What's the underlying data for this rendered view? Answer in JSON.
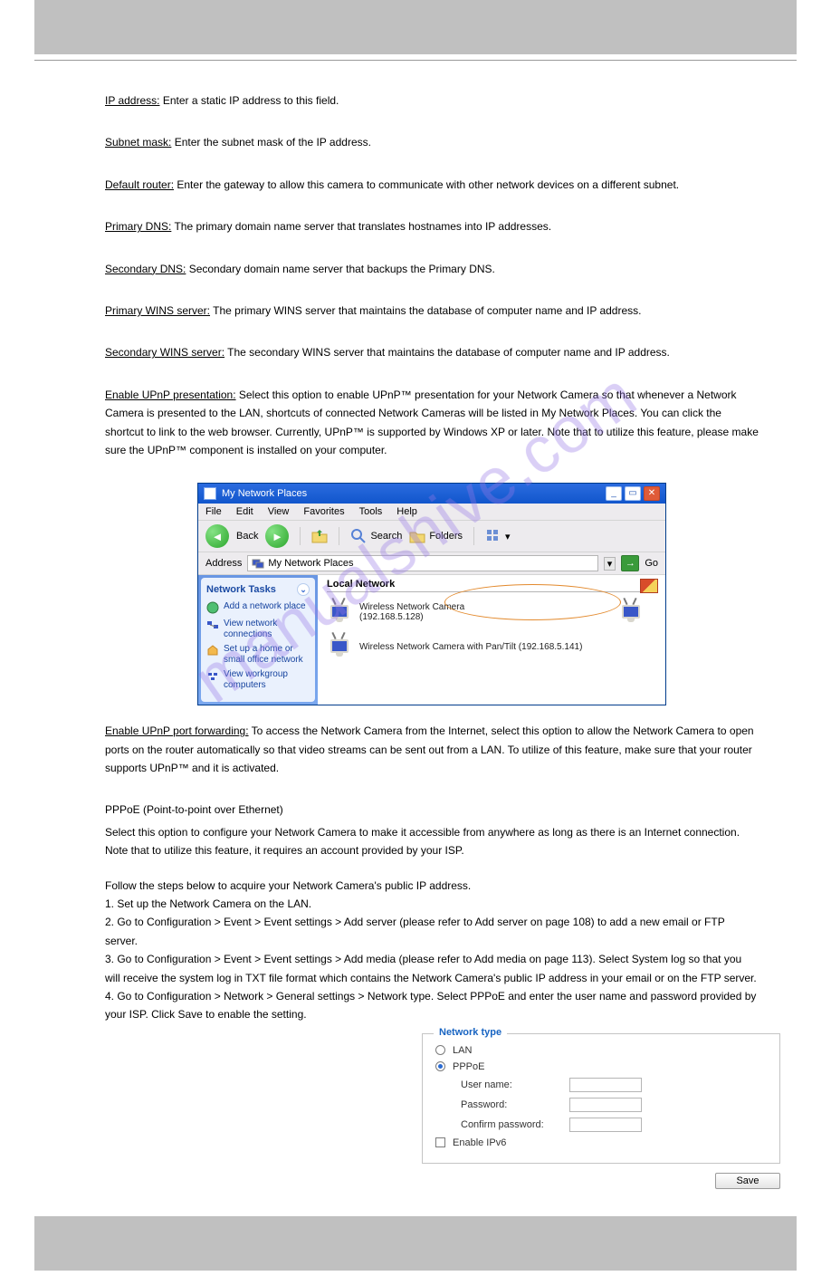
{
  "watermark": "manualshive.com",
  "items": [
    {
      "label": "IP address:",
      "desc": " Enter a static IP address to this field."
    },
    {
      "label": "Subnet mask:",
      "desc": " Enter the subnet mask of the IP address."
    },
    {
      "label": "Default router:",
      "desc": " Enter the gateway to allow this camera to communicate with other network devices on a different subnet."
    },
    {
      "label": "Primary DNS:",
      "desc": " The primary domain name server that translates hostnames into IP addresses."
    },
    {
      "label": "Secondary DNS:",
      "desc": " Secondary domain name server that backups the Primary DNS."
    },
    {
      "label": "Primary WINS server:",
      "desc": " The primary WINS server that maintains the database of computer name and IP address."
    },
    {
      "label": "Secondary WINS server:",
      "desc": " The secondary WINS server that maintains the database of computer name and IP address."
    },
    {
      "label": "Enable UPnP presentation:",
      "desc": " Select this option to enable UPnP™ presentation for your Network Camera so that whenever a Network Camera is presented to the LAN, shortcuts of connected Network Cameras will be listed in My Network Places. You can click the shortcut to link to the web browser. Currently, UPnP™ is supported by Windows XP or later. Note that to utilize this feature, please make sure the UPnP™ component is installed on your computer."
    },
    {
      "label": "Enable UPnP port forwarding:",
      "desc": " To access the Network Camera from the Internet, select this option to allow the Network Camera to open ports on the router automatically so that video streams can be sent out from a LAN. To utilize of this feature, make sure that your router supports UPnP™ and it is activated."
    }
  ],
  "window": {
    "title": "My Network Places",
    "menus": [
      "File",
      "Edit",
      "View",
      "Favorites",
      "Tools",
      "Help"
    ],
    "back": "Back",
    "search": "Search",
    "folders": "Folders",
    "addr_label": "Address",
    "addr_value": "My Network Places",
    "go": "Go",
    "tasks_header": "Network Tasks",
    "tasks": [
      "Add a network place",
      "View network connections",
      "Set up a home or small office network",
      "View workgroup computers"
    ],
    "main_header": "Local Network",
    "net_items": [
      {
        "name": "Wireless Network Camera",
        "addr": "(192.168.5.128)"
      },
      {
        "name": "Wireless Network Camera with Pan/Tilt",
        "addr": "(192.168.5.141)"
      }
    ]
  },
  "pppoe": {
    "legend": "Network type",
    "opt_lan": "LAN",
    "opt_pppoe": "PPPoE",
    "user": "User name:",
    "pass": "Password:",
    "confirm": "Confirm password:",
    "ipv6": "Enable IPv6",
    "save": "Save"
  },
  "pppoe_section": {
    "heading": "PPPoE (Point-to-point over Ethernet)",
    "intro": "Select this option to configure your Network Camera to make it accessible from anywhere as long as there is an Internet connection. Note that to utilize this feature, it requires an account provided by your ISP.",
    "steps_intro": "Follow the steps below to acquire your Network Camera's public IP address.",
    "steps": [
      "1. Set up the Network Camera on the LAN.",
      "2. Go to Configuration > Event > Event settings > Add server (please refer to Add server on page 108) to add a new email or FTP server.",
      "3. Go to Configuration > Event > Event settings > Add media (please refer to Add media on page 113). Select System log so that you will receive the system log in TXT file format which contains the Network Camera's public IP address in your email or on the FTP server.",
      "4. Go to Configuration > Network > General settings > Network type. Select PPPoE and enter the user name and password provided by your ISP. Click Save to enable the setting."
    ]
  }
}
